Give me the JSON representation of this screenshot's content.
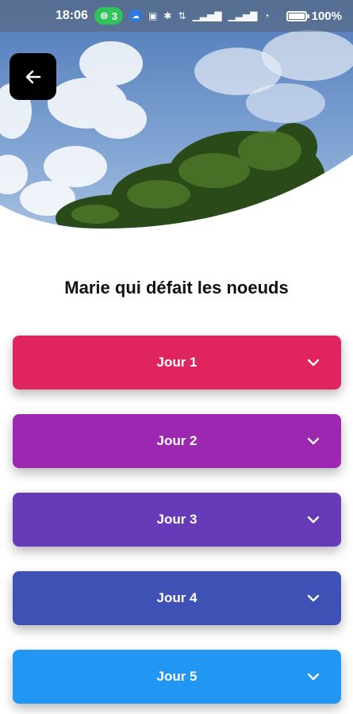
{
  "status_bar": {
    "time": "18:06",
    "hotspot_count": "3",
    "battery": "100%",
    "battery_level": 1.0,
    "icons": [
      "cloud-icon",
      "nfc-icon",
      "bluetooth-icon",
      "data-icon",
      "signal-icon",
      "signal-icon",
      "wifi-icon",
      "battery-icon"
    ]
  },
  "header": {
    "back_icon": "arrow-left-icon"
  },
  "page": {
    "title": "Marie qui défait les noeuds"
  },
  "days": [
    {
      "label": "Jour 1",
      "color": "#e0245e"
    },
    {
      "label": "Jour 2",
      "color": "#9c27b0"
    },
    {
      "label": "Jour 3",
      "color": "#673ab7"
    },
    {
      "label": "Jour 4",
      "color": "#3f51b5"
    },
    {
      "label": "Jour 5",
      "color": "#2196f3"
    }
  ],
  "colors": {
    "background": "#ffffff",
    "back_button": "#000000",
    "text": "#111111"
  }
}
